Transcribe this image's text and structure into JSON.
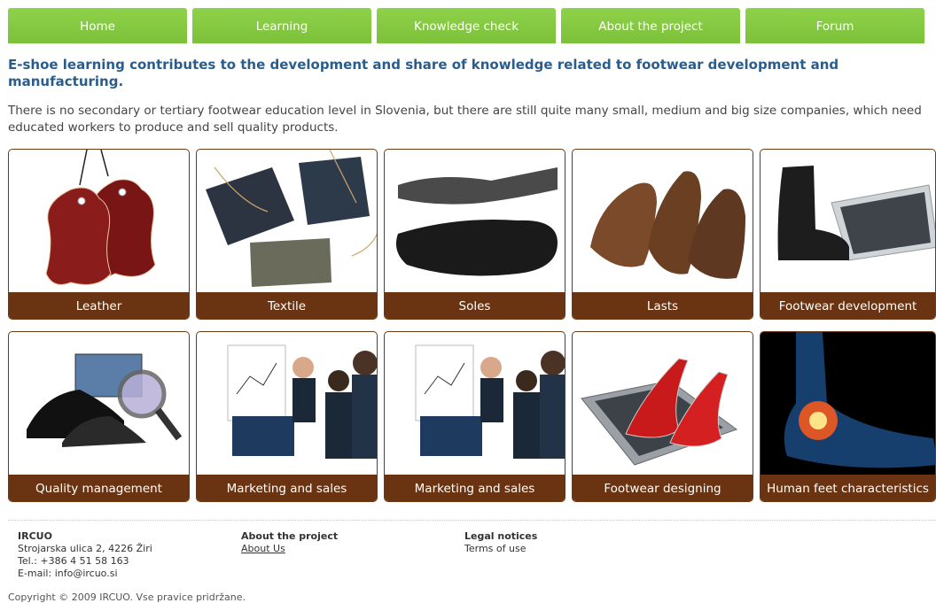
{
  "nav": {
    "items": [
      {
        "label": "Home"
      },
      {
        "label": "Learning"
      },
      {
        "label": "Knowledge check"
      },
      {
        "label": "About the project"
      },
      {
        "label": "Forum"
      }
    ]
  },
  "main": {
    "headline": "E-shoe learning contributes to the development and share of knowledge related to footwear development and manufacturing.",
    "intro": "There is no secondary or tertiary footwear education level in Slovenia, but there are still quite many small, medium and big size companies, which need educated workers to produce and sell quality products."
  },
  "tiles": [
    {
      "label": "Leather"
    },
    {
      "label": "Textile"
    },
    {
      "label": "Soles"
    },
    {
      "label": "Lasts"
    },
    {
      "label": "Footwear development"
    },
    {
      "label": "Quality management"
    },
    {
      "label": "Marketing and sales"
    },
    {
      "label": "Marketing and sales"
    },
    {
      "label": "Footwear designing"
    },
    {
      "label": "Human feet characteristics"
    }
  ],
  "footer": {
    "org": {
      "name": "IRCUO",
      "address": "Strojarska ulica 2, 4226 Žiri",
      "phone": "Tel.: +386 4 51 58 163",
      "email": "E-mail: info@ircuo.si"
    },
    "project": {
      "title": "About the project",
      "link": "About Us"
    },
    "legal": {
      "title": "Legal notices",
      "link": "Terms of use"
    },
    "copyright": "Copyright © 2009 IRCUO. Vse pravice pridržane."
  }
}
